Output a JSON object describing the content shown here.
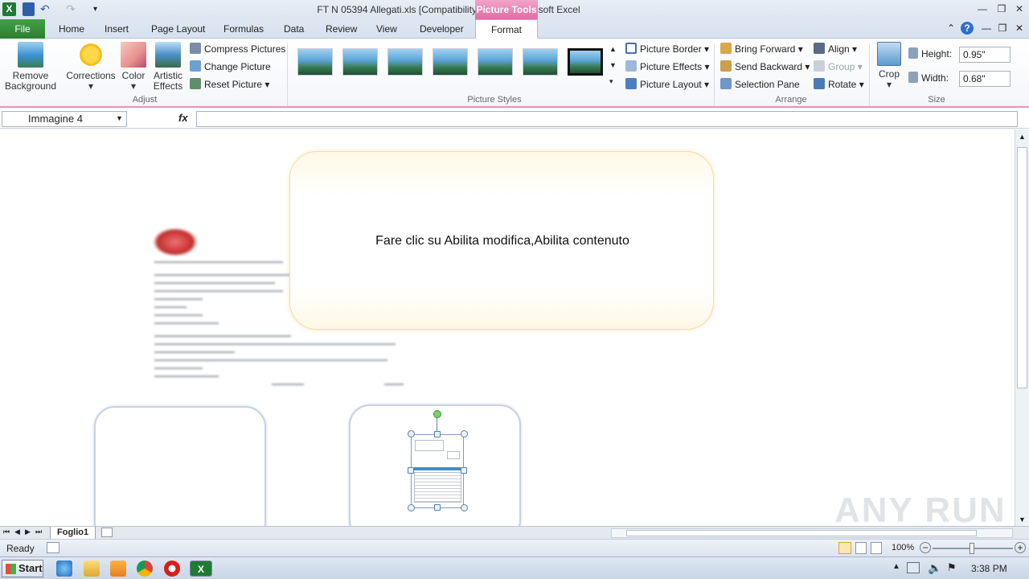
{
  "titlebar": {
    "title": "FT N 05394 Allegati.xls  [Compatibility Mode]  -  Microsoft Excel",
    "contextual_tab_group": "Picture Tools"
  },
  "tabs": {
    "file": "File",
    "home": "Home",
    "insert": "Insert",
    "page_layout": "Page Layout",
    "formulas": "Formulas",
    "data": "Data",
    "review": "Review",
    "view": "View",
    "developer": "Developer",
    "format": "Format"
  },
  "ribbon": {
    "adjust": {
      "remove_background": "Remove Background",
      "corrections": "Corrections",
      "color": "Color",
      "artistic_effects": "Artistic Effects",
      "compress_pictures": "Compress Pictures",
      "change_picture": "Change Picture",
      "reset_picture": "Reset Picture",
      "label": "Adjust"
    },
    "picture_styles": {
      "label": "Picture Styles",
      "picture_border": "Picture Border",
      "picture_effects": "Picture Effects",
      "picture_layout": "Picture Layout"
    },
    "arrange": {
      "label": "Arrange",
      "bring_forward": "Bring Forward",
      "send_backward": "Send Backward",
      "selection_pane": "Selection Pane",
      "align": "Align",
      "group": "Group",
      "rotate": "Rotate"
    },
    "size": {
      "label": "Size",
      "crop": "Crop",
      "height_label": "Height:",
      "height_value": "0.95\"",
      "width_label": "Width:",
      "width_value": "0.68\""
    }
  },
  "formula_bar": {
    "name_box": "Immagine 4",
    "fx": "fx",
    "formula": ""
  },
  "sheet": {
    "callout_text": "Fare clic su Abilita modifica,Abilita contenuto"
  },
  "sheet_tabs": {
    "active": "Foglio1"
  },
  "status": {
    "ready": "Ready",
    "zoom": "100%"
  },
  "taskbar": {
    "start": "Start",
    "clock": "3:38 PM"
  },
  "watermark": "ANY RUN",
  "colors": {
    "file_tab": "#2e7d32",
    "picture_tools": "#e06aa6"
  }
}
